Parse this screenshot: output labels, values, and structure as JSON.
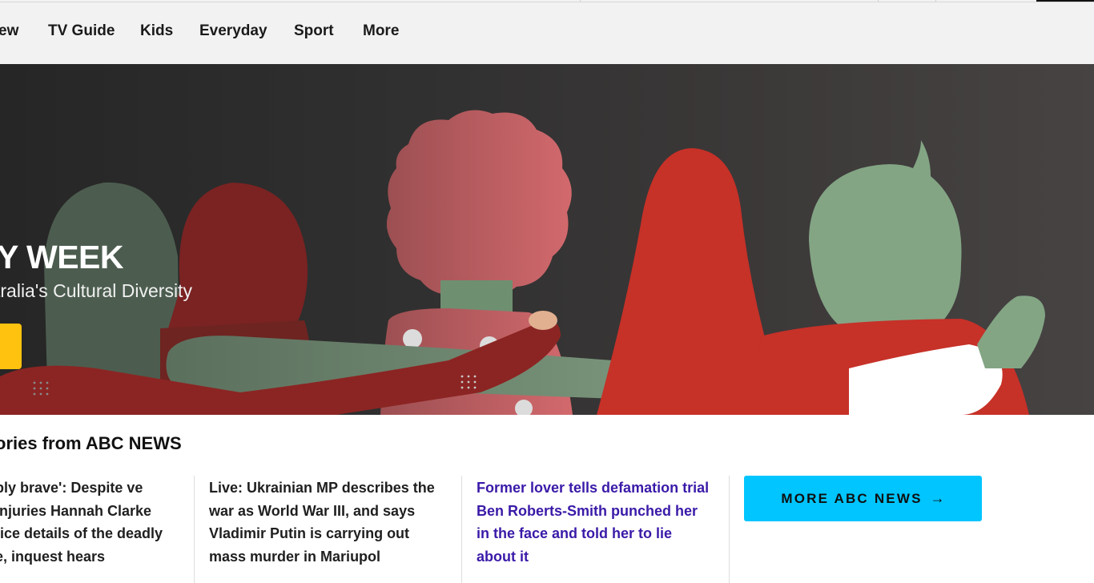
{
  "nav": {
    "items": [
      {
        "label": "ew"
      },
      {
        "label": "TV Guide"
      },
      {
        "label": "Kids"
      },
      {
        "label": "Everyday"
      },
      {
        "label": "Sport"
      },
      {
        "label": "More"
      }
    ]
  },
  "hero": {
    "title": "Y WEEK",
    "subtitle": "tralia's Cultural Diversity",
    "colors": {
      "red": "#c63128",
      "green": "#83a584",
      "pink": "#c96669",
      "dark_red": "#8b2523",
      "cta": "#ffc20e"
    }
  },
  "stories": {
    "heading": "ories from ABC NEWS",
    "items": [
      {
        "headline": "bly brave': Despite ve injuries Hannah Clarke tice details of the deadly e, inquest hears",
        "visited": false
      },
      {
        "headline": "Live: Ukrainian MP describes the war as World War III, and says Vladimir Putin is carrying out mass murder in Mariupol",
        "visited": false
      },
      {
        "headline": "Former lover tells defamation trial Ben Roberts-Smith punched her in the face and told her to lie about it",
        "visited": true
      }
    ],
    "more_label": "MORE ABC NEWS",
    "more_icon": "arrow-right-icon",
    "more_color": "#00c5ff"
  }
}
